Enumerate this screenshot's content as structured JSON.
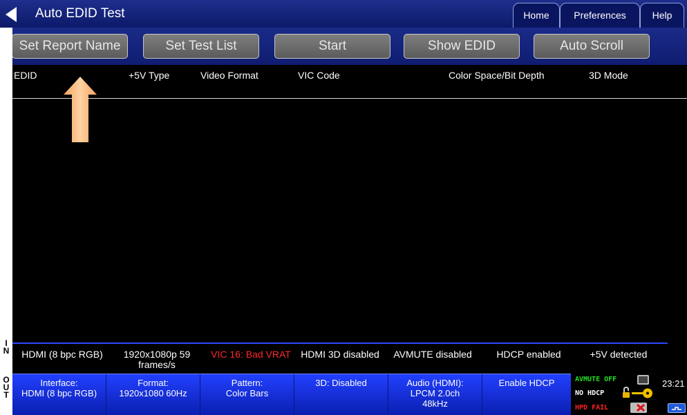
{
  "window": {
    "title": "Auto EDID Test"
  },
  "nav": {
    "home": "Home",
    "preferences": "Preferences",
    "help": "Help"
  },
  "toolbar": {
    "set_report_name": "Set Report Name",
    "set_test_list": "Set Test List",
    "start": "Start",
    "show_edid": "Show EDID",
    "auto_scroll": "Auto Scroll"
  },
  "table": {
    "columns": [
      "EDID",
      "+5V Type",
      "Video Format",
      "VIC Code",
      "Color Space/Bit Depth",
      "3D Mode"
    ],
    "rows": []
  },
  "side_labels": {
    "in": "I N",
    "out": "O U T"
  },
  "input_status": {
    "interface": "HDMI (8 bpc RGB)",
    "format": "1920x1080p 59 frames/s",
    "vic": "VIC 16: Bad VRAT",
    "hdmi3d": "HDMI 3D disabled",
    "avmute": "AVMUTE disabled",
    "hdcp": "HDCP enabled",
    "power": "+5V detected",
    "vic_color": "#ff2a2a"
  },
  "output_status": {
    "interface": "Interface:\nHDMI (8 bpc RGB)",
    "format": "Format:\n1920x1080 60Hz",
    "pattern": "Pattern:\nColor Bars",
    "mode3d": "3D: Disabled",
    "audio": "Audio (HDMI):\nLPCM 2.0ch\n48kHz",
    "hdcp": "Enable HDCP"
  },
  "indicators": {
    "avmute": "AVMUTE OFF",
    "hdcp": "NO HDCP",
    "hpd": "HPD FAIL",
    "avmute_color": "#22dd22",
    "hpd_color": "#ff2222"
  },
  "clock": "23:21"
}
